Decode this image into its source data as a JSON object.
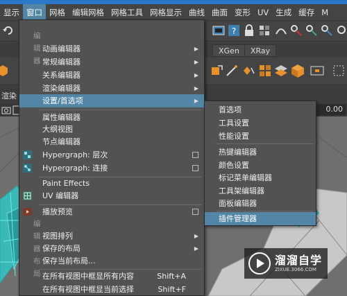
{
  "menubar": {
    "items": [
      "显示",
      "窗口",
      "网格",
      "编辑网格",
      "网格工具",
      "网格显示",
      "曲线",
      "曲面",
      "变形",
      "UV",
      "生成",
      "缓存",
      "M"
    ],
    "active_index": 1
  },
  "shelf_tabs": [
    "XGen",
    "XRay"
  ],
  "panel": {
    "left_label": "渲染",
    "value": "0.00"
  },
  "window_menu": {
    "section_editors": "编辑器",
    "items": [
      {
        "label": "动画编辑器",
        "arrow": true
      },
      {
        "label": "常规编辑器",
        "arrow": true
      },
      {
        "label": "关系编辑器",
        "arrow": true
      },
      {
        "label": "渲染编辑器",
        "arrow": true
      },
      {
        "label": "设置/首选项",
        "arrow": true,
        "highlighted": true
      },
      {
        "label": "属性编辑器"
      },
      {
        "label": "大纲视图"
      },
      {
        "label": "节点编辑器"
      },
      {
        "label": "Hypergraph: 层次",
        "option_box": true
      },
      {
        "label": "Hypergraph: 连接",
        "option_box": true
      },
      {
        "label": "Paint Effects"
      },
      {
        "label": "UV 编辑器"
      },
      {
        "label": "播放预览",
        "option_box": true
      }
    ],
    "section_layouts": "编辑器布局",
    "layout_items": [
      {
        "label": "视图排列",
        "arrow": true
      },
      {
        "label": "保存的布局",
        "arrow": true
      },
      {
        "label": "保存当前布局..."
      }
    ],
    "frame_items": [
      {
        "label": "在所有视图中框显所有内容",
        "shortcut": "Shift+A"
      },
      {
        "label": "在所有视图中框显当前选择",
        "shortcut": "Shift+F"
      }
    ]
  },
  "settings_submenu": {
    "items": [
      {
        "label": "首选项"
      },
      {
        "label": "工具设置"
      },
      {
        "label": "性能设置"
      },
      {
        "label": "热键编辑器"
      },
      {
        "label": "颜色设置"
      },
      {
        "label": "标记菜单编辑器"
      },
      {
        "label": "工具架编辑器"
      },
      {
        "label": "面板编辑器"
      },
      {
        "label": "插件管理器",
        "highlighted": true
      }
    ]
  },
  "watermark": {
    "title": "溜溜自学",
    "url": "ZIXUE.3066.COM"
  },
  "colors": {
    "highlight": "#5285a6",
    "menu_bg": "#525252",
    "menubar_bg": "#444444"
  }
}
